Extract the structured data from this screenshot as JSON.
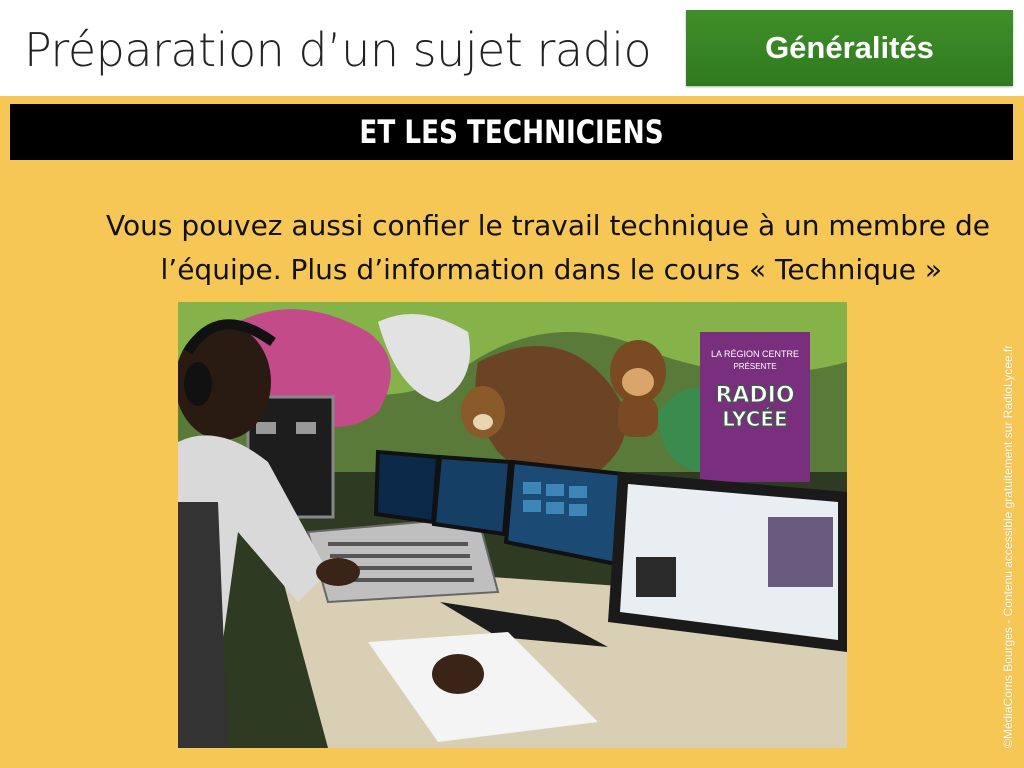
{
  "header": {
    "title": "Préparation d’un sujet radio",
    "badge": "Généralités"
  },
  "section": {
    "heading": "ET LES TECHNICIENS"
  },
  "body": {
    "line1": "Vous pouvez aussi confier le travail technique à un membre de",
    "line2": "l’équipe. Plus d’information dans le cours « Technique »"
  },
  "photo": {
    "sign_line1": "LA RÉGION CENTRE",
    "sign_line2": "PRÉSENTE",
    "sign_brand": "RADIO",
    "sign_brand2": "LYCÉE"
  },
  "credit": "©MédiaComs Bourges - Contenu accessible gratuitement sur RadioLycee.fr",
  "colors": {
    "background": "#F6C754",
    "badge": "#3A8A25",
    "bar": "#000000"
  }
}
